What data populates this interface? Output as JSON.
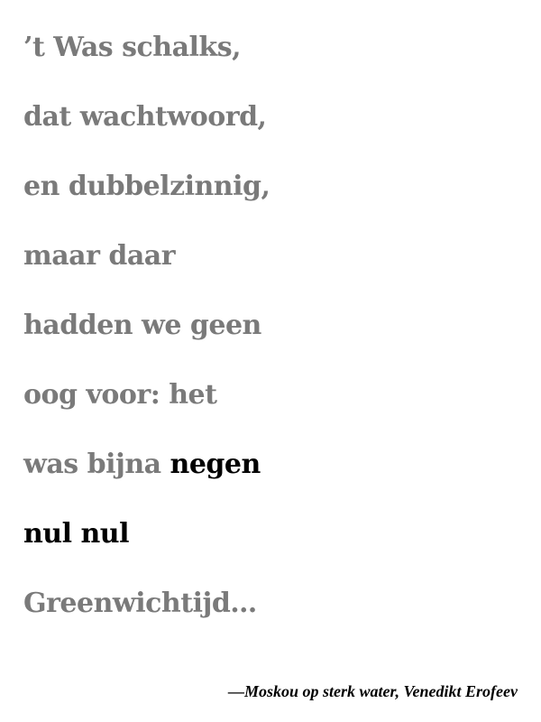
{
  "quote": {
    "lines": [
      "’t Was schalks,",
      "dat wachtwoord,",
      "en dubbelzinnig,",
      "maar daar",
      "hadden we geen",
      "oog voor: het"
    ],
    "line7_prefix": "was bijna ",
    "line7_emphasis": "negen",
    "line8_emphasis": "nul nul",
    "last_line": "Greenwichtijd…"
  },
  "attribution": "—Moskou op sterk water, Venedikt Erofeev",
  "colors": {
    "body_text": "#7a7a7a",
    "emphasis_text": "#000000",
    "background": "#ffffff"
  }
}
